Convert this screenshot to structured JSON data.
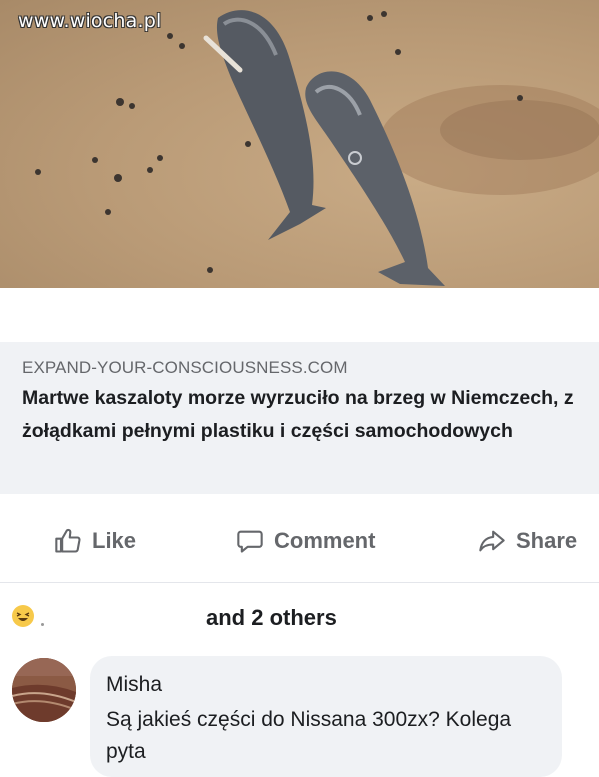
{
  "photo": {
    "watermark": "www.wiocha.pl"
  },
  "link_preview": {
    "domain": "EXPAND-YOUR-CONSCIOUSNESS.COM",
    "headline": "Martwe kaszaloty morze wyrzuciło na brzeg w Niemczech, z żołądkami pełnymi plastiku i części samochodowych"
  },
  "actions": {
    "like_label": "Like",
    "comment_label": "Comment",
    "share_label": "Share"
  },
  "reactions": {
    "icon": "haha-emoji-icon",
    "others_text": "and 2 others"
  },
  "comment": {
    "author": "Misha",
    "text": "Są jakieś części do Nissana 300zx? Kolega pyta"
  },
  "colors": {
    "sand": "#b99a76",
    "link_bg": "#f0f2f5",
    "muted_text": "#65676b",
    "primary_text": "#1c1e21"
  }
}
